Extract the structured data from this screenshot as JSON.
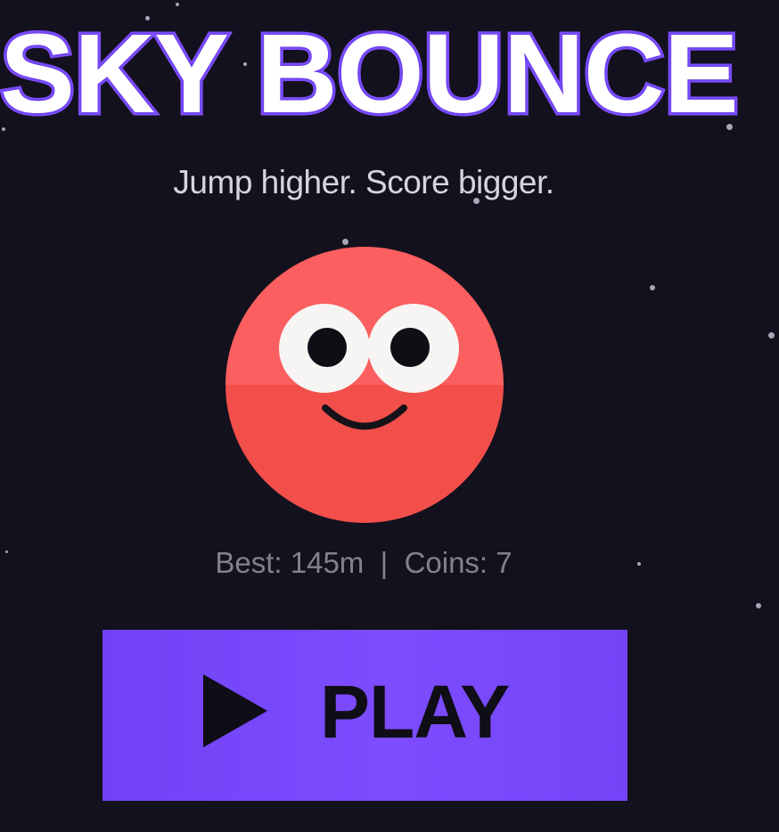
{
  "game": {
    "title": "SKY BOUNCE",
    "tagline": "Jump higher. Score bigger.",
    "stats": {
      "best_label": "Best:",
      "best_value": "145m",
      "separator": "|",
      "coins_label": "Coins:",
      "coins_value": "7"
    },
    "play_button": {
      "label": "PLAY",
      "icon": "play-icon"
    },
    "character": {
      "icon": "ball-character"
    }
  },
  "colors": {
    "background": "#13111d",
    "title_fill": "#ffffff",
    "title_outline": "#7c4dff",
    "ball_top": "#fb5f5f",
    "ball_bottom": "#f24f4b",
    "button": "#7b4bff",
    "button_text": "#0f0d16",
    "stats_text": "#84818f",
    "tagline_text": "#d6d5df"
  }
}
